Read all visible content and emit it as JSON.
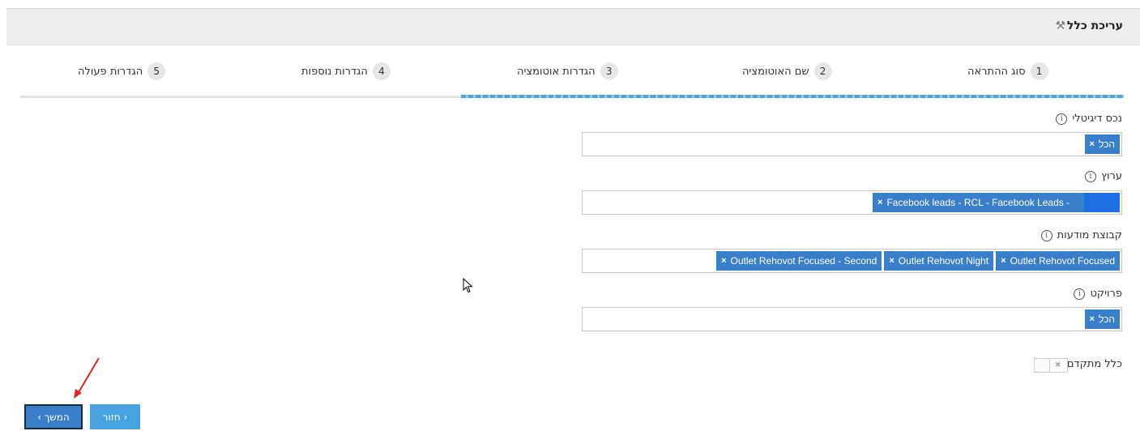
{
  "header": {
    "title": "עריכת כלל",
    "icon": "wrench-icon"
  },
  "steps": [
    {
      "num": "1",
      "label": "סוג ההתראה"
    },
    {
      "num": "2",
      "label": "שם האוטומציה"
    },
    {
      "num": "3",
      "label": "הגדרות אוטומציה"
    },
    {
      "num": "4",
      "label": "הגדרות נוספות"
    },
    {
      "num": "5",
      "label": "הגדרות פעולה"
    }
  ],
  "fields": {
    "digital_asset": {
      "label": "נכס דיגיטלי",
      "tags": [
        "הכל"
      ]
    },
    "channel": {
      "label": "ערוץ",
      "tags": [
        "Facebook leads - RCL - Facebook Leads -"
      ]
    },
    "ad_group": {
      "label": "קבוצת מודעות",
      "tags": [
        "Outlet Rehovot Focused",
        "Outlet Rehovot Night",
        "Outlet Rehovot Focused - Second"
      ]
    },
    "project": {
      "label": "פרויקט",
      "tags": [
        "הכל"
      ]
    }
  },
  "advanced_rule": {
    "label": "כלל מתקדם",
    "enabled": false
  },
  "buttons": {
    "next": "המשך ›",
    "back": "‹ חזור"
  },
  "colors": {
    "tag": "#3a7fc9",
    "progress": "#4aa6d6",
    "header_bg": "#eeeeee"
  }
}
